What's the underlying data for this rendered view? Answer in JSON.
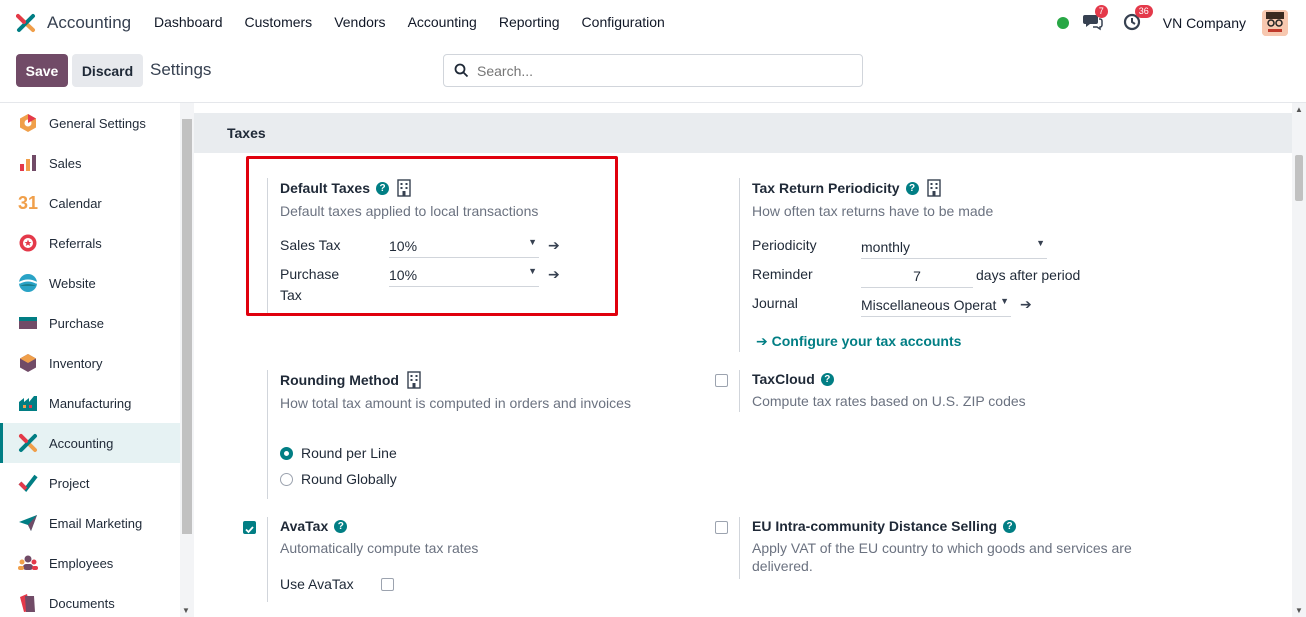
{
  "app": {
    "name": "Accounting"
  },
  "menu": [
    "Dashboard",
    "Customers",
    "Vendors",
    "Accounting",
    "Reporting",
    "Configuration"
  ],
  "nav_right": {
    "messages_count": "7",
    "activities_count": "36",
    "company": "VN Company"
  },
  "control": {
    "save": "Save",
    "discard": "Discard",
    "title": "Settings",
    "search_placeholder": "Search..."
  },
  "sidebar": [
    {
      "label": "General Settings",
      "icon": "general-settings-icon"
    },
    {
      "label": "Sales",
      "icon": "sales-icon"
    },
    {
      "label": "Calendar",
      "icon": "calendar-icon",
      "glyph": "31"
    },
    {
      "label": "Referrals",
      "icon": "referrals-icon"
    },
    {
      "label": "Website",
      "icon": "website-icon"
    },
    {
      "label": "Purchase",
      "icon": "purchase-icon"
    },
    {
      "label": "Inventory",
      "icon": "inventory-icon"
    },
    {
      "label": "Manufacturing",
      "icon": "manufacturing-icon"
    },
    {
      "label": "Accounting",
      "icon": "accounting-icon",
      "active": true
    },
    {
      "label": "Project",
      "icon": "project-icon"
    },
    {
      "label": "Email Marketing",
      "icon": "email-marketing-icon"
    },
    {
      "label": "Employees",
      "icon": "employees-icon"
    },
    {
      "label": "Documents",
      "icon": "documents-icon"
    }
  ],
  "section": {
    "title": "Taxes"
  },
  "default_taxes": {
    "title": "Default Taxes",
    "desc": "Default taxes applied to local transactions",
    "sales_label": "Sales Tax",
    "sales_value": "10%",
    "purchase_label_1": "Purchase",
    "purchase_label_2": "Tax",
    "purchase_value": "10%"
  },
  "tax_return": {
    "title": "Tax Return Periodicity",
    "desc": "How often tax returns have to be made",
    "periodicity_label": "Periodicity",
    "periodicity_value": "monthly",
    "reminder_label": "Reminder",
    "reminder_value": "7",
    "reminder_suffix": "days after period",
    "journal_label": "Journal",
    "journal_value": "Miscellaneous Operat",
    "configure_link": "Configure your tax accounts"
  },
  "rounding": {
    "title": "Rounding Method",
    "desc": "How total tax amount is computed in orders and invoices",
    "opt1": "Round per Line",
    "opt2": "Round Globally",
    "selected": "Round per Line"
  },
  "taxcloud": {
    "title": "TaxCloud",
    "desc": "Compute tax rates based on U.S. ZIP codes",
    "checked": false
  },
  "avatax": {
    "title": "AvaTax",
    "desc": "Automatically compute tax rates",
    "use_label": "Use AvaTax",
    "checked": true,
    "use_checked": false
  },
  "eu_oss": {
    "title": "EU Intra-community Distance Selling",
    "desc1": "Apply VAT of the EU country to which goods and services are",
    "desc2": "delivered.",
    "checked": false
  },
  "colors": {
    "brand": "#714b67",
    "accent": "#017e84",
    "highlight": "#e0000d"
  }
}
